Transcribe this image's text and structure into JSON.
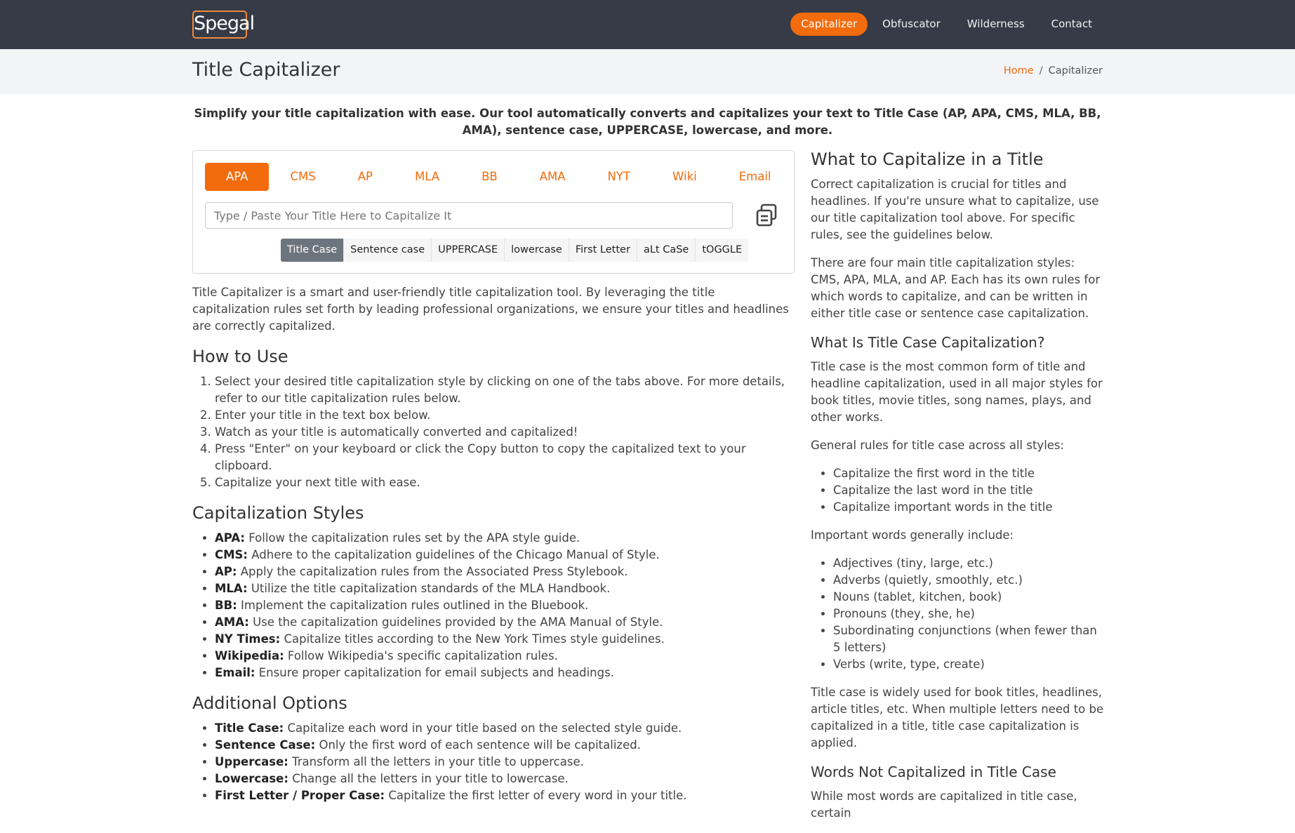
{
  "header": {
    "logo": "Spegal",
    "nav": [
      "Capitalizer",
      "Obfuscator",
      "Wilderness",
      "Contact"
    ]
  },
  "subheader": {
    "title": "Title Capitalizer",
    "breadcrumb_home": "Home",
    "breadcrumb_sep": "/",
    "breadcrumb_current": "Capitalizer"
  },
  "intro": "Simplify your title capitalization with ease. Our tool automatically converts and capitalizes your text to Title Case (AP, APA, CMS, MLA, BB, AMA), sentence case, UPPERCASE, lowercase, and more.",
  "tool": {
    "style_tabs": [
      "APA",
      "CMS",
      "AP",
      "MLA",
      "BB",
      "AMA",
      "NYT",
      "Wiki",
      "Email"
    ],
    "input_placeholder": "Type / Paste Your Title Here to Capitalize It",
    "input_value": "",
    "case_buttons": [
      "Title Case",
      "Sentence case",
      "UPPERCASE",
      "lowercase",
      "First Letter",
      "aLt CaSe",
      "tOGGLE"
    ]
  },
  "left": {
    "description": "Title Capitalizer is a smart and user-friendly title capitalization tool. By leveraging the title capitalization rules set forth by leading professional organizations, we ensure your titles and headlines are correctly capitalized.",
    "how_to_heading": "How to Use",
    "how_to_steps": [
      "Select your desired title capitalization style by clicking on one of the tabs above. For more details, refer to our title capitalization rules below.",
      "Enter your title in the text box below.",
      "Watch as your title is automatically converted and capitalized!",
      "Press \"Enter\" on your keyboard or click the Copy button to copy the capitalized text to your clipboard.",
      "Capitalize your next title with ease."
    ],
    "styles_heading": "Capitalization Styles",
    "styles": [
      {
        "term": "APA:",
        "desc": " Follow the capitalization rules set by the APA style guide."
      },
      {
        "term": "CMS:",
        "desc": " Adhere to the capitalization guidelines of the Chicago Manual of Style."
      },
      {
        "term": "AP:",
        "desc": " Apply the capitalization rules from the Associated Press Stylebook."
      },
      {
        "term": "MLA:",
        "desc": " Utilize the title capitalization standards of the MLA Handbook."
      },
      {
        "term": "BB:",
        "desc": " Implement the capitalization rules outlined in the Bluebook."
      },
      {
        "term": "AMA:",
        "desc": " Use the capitalization guidelines provided by the AMA Manual of Style."
      },
      {
        "term": "NY Times:",
        "desc": " Capitalize titles according to the New York Times style guidelines."
      },
      {
        "term": "Wikipedia:",
        "desc": " Follow Wikipedia's specific capitalization rules."
      },
      {
        "term": "Email:",
        "desc": " Ensure proper capitalization for email subjects and headings."
      }
    ],
    "options_heading": "Additional Options",
    "options": [
      {
        "term": "Title Case:",
        "desc": " Capitalize each word in your title based on the selected style guide."
      },
      {
        "term": "Sentence Case:",
        "desc": " Only the first word of each sentence will be capitalized."
      },
      {
        "term": "Uppercase:",
        "desc": " Transform all the letters in your title to uppercase."
      },
      {
        "term": "Lowercase:",
        "desc": " Change all the letters in your title to lowercase."
      },
      {
        "term": "First Letter / Proper Case:",
        "desc": " Capitalize the first letter of every word in your title."
      }
    ]
  },
  "right": {
    "heading1": "What to Capitalize in a Title",
    "p1": "Correct capitalization is crucial for titles and headlines. If you're unsure what to capitalize, use our title capitalization tool above. For specific rules, see the guidelines below.",
    "p2": "There are four main title capitalization styles: CMS, APA, MLA, and AP. Each has its own rules for which words to capitalize, and can be written in either title case or sentence case capitalization.",
    "heading2": "What Is Title Case Capitalization?",
    "p3": "Title case is the most common form of title and headline capitalization, used in all major styles for book titles, movie titles, song names, plays, and other works.",
    "p4": "General rules for title case across all styles:",
    "rules": [
      "Capitalize the first word in the title",
      "Capitalize the last word in the title",
      "Capitalize important words in the title"
    ],
    "p5": "Important words generally include:",
    "important": [
      "Adjectives (tiny, large, etc.)",
      "Adverbs (quietly, smoothly, etc.)",
      "Nouns (tablet, kitchen, book)",
      "Pronouns (they, she, he)",
      "Subordinating conjunctions (when fewer than 5 letters)",
      "Verbs (write, type, create)"
    ],
    "p6": "Title case is widely used for book titles, headlines, article titles, etc. When multiple letters need to be capitalized in a title, title case capitalization is applied.",
    "heading3": "Words Not Capitalized in Title Case",
    "p7": "While most words are capitalized in title case, certain"
  }
}
